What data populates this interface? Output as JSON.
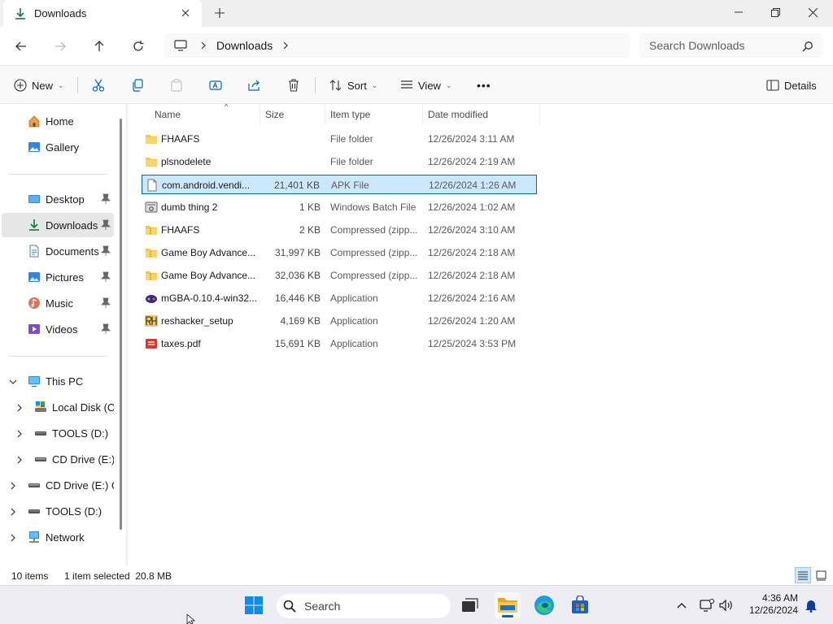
{
  "window": {
    "tab_title": "Downloads",
    "new_tab_symbol": "+",
    "controls": [
      "minimize",
      "maximize",
      "close"
    ]
  },
  "navigation": {
    "breadcrumb": [
      "Downloads"
    ],
    "search_placeholder": "Search Downloads"
  },
  "commands": {
    "new_label": "New",
    "sort_label": "Sort",
    "view_label": "View",
    "details_label": "Details",
    "more_symbol": "•••"
  },
  "sidebar": {
    "home": "Home",
    "gallery": "Gallery",
    "quick_access": [
      {
        "label": "Desktop",
        "icon": "desktop-icon"
      },
      {
        "label": "Downloads",
        "icon": "download-icon",
        "selected": true
      },
      {
        "label": "Documents",
        "icon": "documents-icon"
      },
      {
        "label": "Pictures",
        "icon": "pictures-icon"
      },
      {
        "label": "Music",
        "icon": "music-icon"
      },
      {
        "label": "Videos",
        "icon": "videos-icon"
      }
    ],
    "this_pc": "This PC",
    "this_pc_children": [
      {
        "label": "Local Disk (C:)",
        "icon": "local-disk-icon"
      },
      {
        "label": "TOOLS (D:)",
        "icon": "drive-icon"
      },
      {
        "label": "CD Drive (E:) G",
        "icon": "cd-drive-icon"
      }
    ],
    "top_level": [
      {
        "label": "CD Drive (E:) GP",
        "icon": "cd-drive-icon"
      },
      {
        "label": "TOOLS (D:)",
        "icon": "drive-icon"
      },
      {
        "label": "Network",
        "icon": "network-icon"
      }
    ]
  },
  "file_list": {
    "columns": {
      "name": "Name",
      "size": "Size",
      "type": "Item type",
      "date": "Date modified"
    },
    "sort_symbol": "^",
    "rows": [
      {
        "name": "FHAAFS",
        "size": "",
        "type": "File folder",
        "date": "12/26/2024 3:11 AM",
        "icon": "folder-icon"
      },
      {
        "name": "plsnodelete",
        "size": "",
        "type": "File folder",
        "date": "12/26/2024 2:19 AM",
        "icon": "folder-icon"
      },
      {
        "name": "com.android.vendi...",
        "size": "21,401 KB",
        "type": "APK File",
        "date": "12/26/2024 1:26 AM",
        "icon": "file-icon",
        "selected": true
      },
      {
        "name": "dumb thing 2",
        "size": "1 KB",
        "type": "Windows Batch File",
        "date": "12/26/2024 1:02 AM",
        "icon": "batch-file-icon"
      },
      {
        "name": "FHAAFS",
        "size": "2 KB",
        "type": "Compressed (zipp...",
        "date": "12/26/2024 3:10 AM",
        "icon": "zip-folder-icon"
      },
      {
        "name": "Game Boy Advance...",
        "size": "31,997 KB",
        "type": "Compressed (zipp...",
        "date": "12/26/2024 2:18 AM",
        "icon": "zip-folder-icon"
      },
      {
        "name": "Game Boy Advance...",
        "size": "32,036 KB",
        "type": "Compressed (zipp...",
        "date": "12/26/2024 2:18 AM",
        "icon": "zip-folder-icon"
      },
      {
        "name": "mGBA-0.10.4-win32...",
        "size": "16,446 KB",
        "type": "Application",
        "date": "12/26/2024 2:16 AM",
        "icon": "mgba-app-icon"
      },
      {
        "name": "reshacker_setup",
        "size": "4,169 KB",
        "type": "Application",
        "date": "12/26/2024 1:20 AM",
        "icon": "reshacker-app-icon"
      },
      {
        "name": "taxes.pdf",
        "size": "15,691 KB",
        "type": "Application",
        "date": "12/25/2024 3:53 PM",
        "icon": "pdf-icon"
      }
    ]
  },
  "status_bar": {
    "item_count": "10 items",
    "selection": "1 item selected  20.8 MB"
  },
  "taskbar": {
    "search_label": "Search",
    "time": "4:36 AM",
    "date": "12/26/2024"
  },
  "colors": {
    "accent": "#0067c0",
    "selection_bg": "#cce8ff",
    "folder_yellow": "#f6c244"
  }
}
